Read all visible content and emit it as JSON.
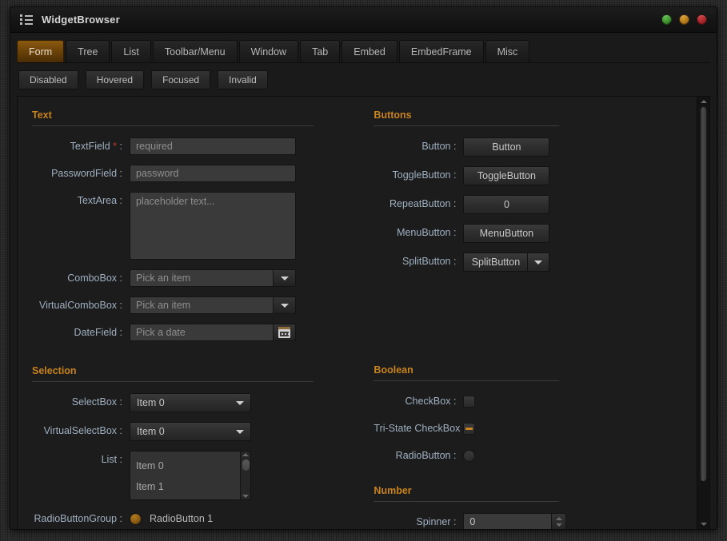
{
  "window": {
    "title": "WidgetBrowser",
    "menu_icon": "list-menu-icon",
    "controls": [
      {
        "name": "minimize-button",
        "color": "#3f8f2f"
      },
      {
        "name": "maximize-button",
        "color": "#b4791a"
      },
      {
        "name": "close-button",
        "color": "#a32428"
      }
    ]
  },
  "tabs": [
    {
      "label": "Form",
      "active": true
    },
    {
      "label": "Tree",
      "active": false
    },
    {
      "label": "List",
      "active": false
    },
    {
      "label": "Toolbar/Menu",
      "active": false
    },
    {
      "label": "Window",
      "active": false
    },
    {
      "label": "Tab",
      "active": false
    },
    {
      "label": "Embed",
      "active": false
    },
    {
      "label": "EmbedFrame",
      "active": false
    },
    {
      "label": "Misc",
      "active": false
    }
  ],
  "state_buttons": [
    {
      "label": "Disabled"
    },
    {
      "label": "Hovered"
    },
    {
      "label": "Focused"
    },
    {
      "label": "Invalid"
    }
  ],
  "sections": {
    "text": {
      "title": "Text",
      "fields": {
        "textfield": {
          "label": "TextField",
          "required_mark": "*",
          "colon": ":",
          "placeholder": "required"
        },
        "passwordfield": {
          "label": "PasswordField :",
          "placeholder": "password"
        },
        "textarea": {
          "label": "TextArea :",
          "placeholder": "placeholder text..."
        },
        "combobox": {
          "label": "ComboBox :",
          "placeholder": "Pick an item",
          "arrow": "chevron-down-icon"
        },
        "virtualcombobox": {
          "label": "VirtualComboBox :",
          "placeholder": "Pick an item",
          "arrow": "chevron-down-icon"
        },
        "datefield": {
          "label": "DateField :",
          "placeholder": "Pick a date",
          "icon": "calendar-icon"
        }
      }
    },
    "selection": {
      "title": "Selection",
      "fields": {
        "selectbox": {
          "label": "SelectBox :",
          "value": "Item 0",
          "arrow": "chevron-down-icon"
        },
        "virtualselectbox": {
          "label": "VirtualSelectBox :",
          "value": "Item 0",
          "arrow": "chevron-down-icon"
        },
        "list": {
          "label": "List :",
          "items": [
            "Item 0",
            "Item 1"
          ]
        },
        "radiobuttongroup": {
          "label": "RadioButtonGroup :",
          "option": "RadioButton 1",
          "selected": true
        }
      }
    },
    "buttons": {
      "title": "Buttons",
      "fields": {
        "button": {
          "label": "Button :",
          "value": "Button"
        },
        "togglebutton": {
          "label": "ToggleButton :",
          "value": "ToggleButton"
        },
        "repeatbutton": {
          "label": "RepeatButton :",
          "value": "0"
        },
        "menubutton": {
          "label": "MenuButton :",
          "value": "MenuButton"
        },
        "splitbutton": {
          "label": "SplitButton :",
          "value": "SplitButton",
          "arrow": "chevron-down-icon"
        }
      }
    },
    "boolean": {
      "title": "Boolean",
      "fields": {
        "checkbox": {
          "label": "CheckBox :",
          "state": "unchecked"
        },
        "tristate": {
          "label": "Tri-State CheckBox :",
          "state": "indeterminate"
        },
        "radiobutton": {
          "label": "RadioButton :",
          "state": "unselected"
        }
      }
    },
    "number": {
      "title": "Number",
      "fields": {
        "spinner": {
          "label": "Spinner :",
          "value": "0"
        }
      }
    }
  },
  "colors": {
    "accent": "#c8821e",
    "active_tab": "#6d4409",
    "label": "#9fb0c0",
    "required": "#c0392b",
    "window_bg": "#1a1a1a"
  }
}
